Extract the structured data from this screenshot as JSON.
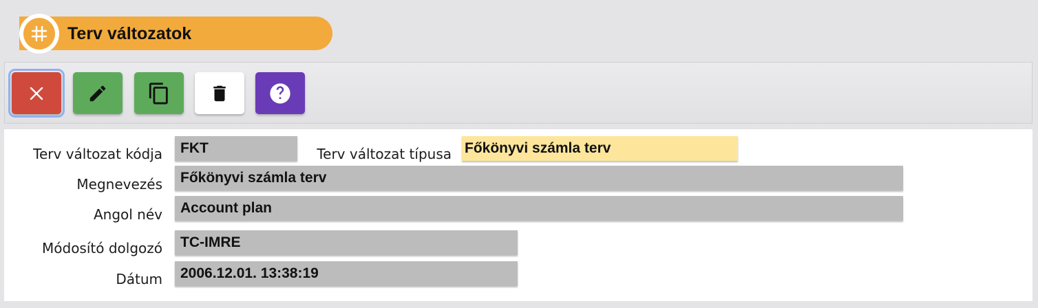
{
  "header": {
    "title": "Terv változatok",
    "icon": "hash-icon",
    "accent_color": "#f3aa3c"
  },
  "toolbar": {
    "buttons": [
      {
        "name": "close",
        "icon": "close-icon",
        "color": "#cf4a3c"
      },
      {
        "name": "edit",
        "icon": "pencil-icon",
        "color": "#5dab5a"
      },
      {
        "name": "copy",
        "icon": "copy-icon",
        "color": "#5dab5a"
      },
      {
        "name": "delete",
        "icon": "trash-icon",
        "color": "#ffffff"
      },
      {
        "name": "help",
        "icon": "help-icon",
        "color": "#6a3bb6"
      }
    ]
  },
  "form": {
    "code_label": "Terv változat kódja",
    "code_value": "FKT",
    "type_label": "Terv változat típusa",
    "type_value": "Főkönyvi számla terv",
    "name_label": "Megnevezés",
    "name_value": "Főkönyvi számla terv",
    "english_label": "Angol név",
    "english_value": "Account plan",
    "modifier_label": "Módosító dolgozó",
    "modifier_value": "TC-IMRE",
    "date_label": "Dátum",
    "date_value": "2006.12.01. 13:38:19"
  }
}
